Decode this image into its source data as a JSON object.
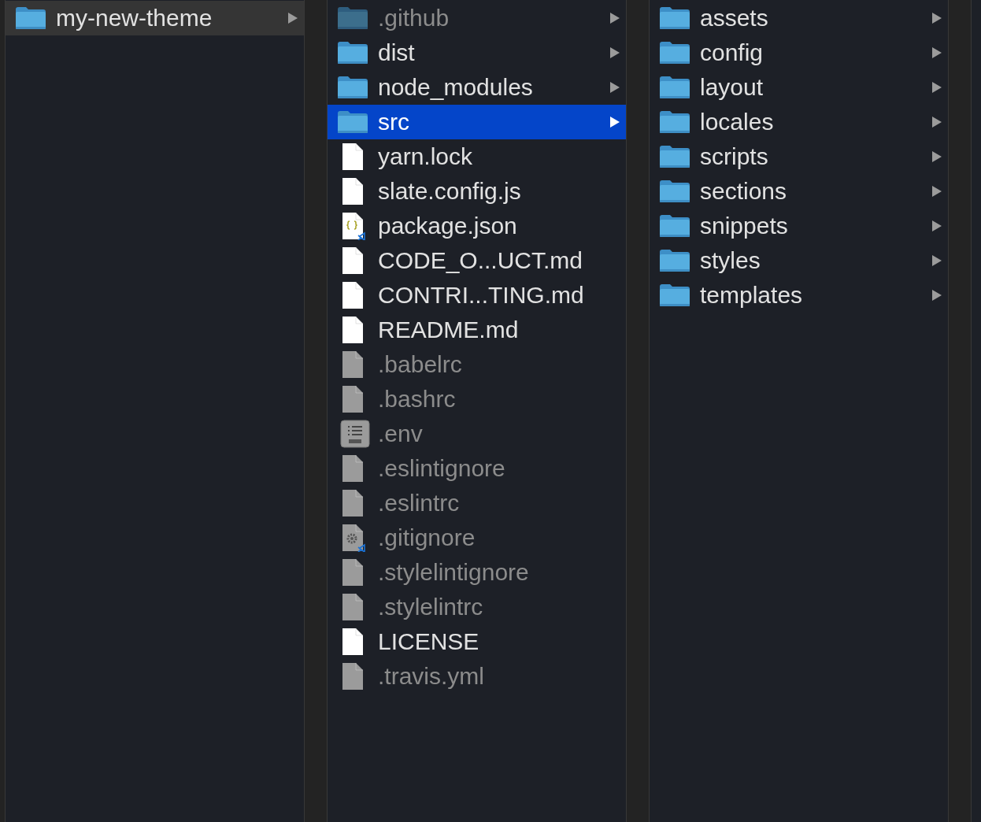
{
  "columns": [
    {
      "focused": false,
      "items": [
        {
          "name": "my-new-theme",
          "kind": "folder",
          "hidden": false,
          "selected": true
        }
      ]
    },
    {
      "focused": true,
      "items": [
        {
          "name": ".github",
          "kind": "folder",
          "hidden": true,
          "selected": false
        },
        {
          "name": "dist",
          "kind": "folder",
          "hidden": false,
          "selected": false
        },
        {
          "name": "node_modules",
          "kind": "folder",
          "hidden": false,
          "selected": false
        },
        {
          "name": "src",
          "kind": "folder",
          "hidden": false,
          "selected": true
        },
        {
          "name": "yarn.lock",
          "kind": "document",
          "hidden": false,
          "selected": false
        },
        {
          "name": "slate.config.js",
          "kind": "document",
          "hidden": false,
          "selected": false
        },
        {
          "name": "package.json",
          "kind": "json-document",
          "hidden": false,
          "selected": false
        },
        {
          "name": "CODE_O...UCT.md",
          "kind": "document",
          "hidden": false,
          "selected": false
        },
        {
          "name": "CONTRI...TING.md",
          "kind": "document",
          "hidden": false,
          "selected": false
        },
        {
          "name": "README.md",
          "kind": "document",
          "hidden": false,
          "selected": false
        },
        {
          "name": ".babelrc",
          "kind": "document",
          "hidden": true,
          "selected": false
        },
        {
          "name": ".bashrc",
          "kind": "document",
          "hidden": true,
          "selected": false
        },
        {
          "name": ".env",
          "kind": "dict-document",
          "hidden": true,
          "selected": false
        },
        {
          "name": ".eslintignore",
          "kind": "document",
          "hidden": true,
          "selected": false
        },
        {
          "name": ".eslintrc",
          "kind": "document",
          "hidden": true,
          "selected": false
        },
        {
          "name": ".gitignore",
          "kind": "settings-document",
          "hidden": true,
          "selected": false
        },
        {
          "name": ".stylelintignore",
          "kind": "document",
          "hidden": true,
          "selected": false
        },
        {
          "name": ".stylelintrc",
          "kind": "document",
          "hidden": true,
          "selected": false
        },
        {
          "name": "LICENSE",
          "kind": "document",
          "hidden": false,
          "selected": false
        },
        {
          "name": ".travis.yml",
          "kind": "document",
          "hidden": true,
          "selected": false
        }
      ]
    },
    {
      "items": [
        {
          "name": "assets",
          "kind": "folder",
          "hidden": false,
          "selected": false
        },
        {
          "name": "config",
          "kind": "folder",
          "hidden": false,
          "selected": false
        },
        {
          "name": "layout",
          "kind": "folder",
          "hidden": false,
          "selected": false
        },
        {
          "name": "locales",
          "kind": "folder",
          "hidden": false,
          "selected": false
        },
        {
          "name": "scripts",
          "kind": "folder",
          "hidden": false,
          "selected": false
        },
        {
          "name": "sections",
          "kind": "folder",
          "hidden": false,
          "selected": false
        },
        {
          "name": "snippets",
          "kind": "folder",
          "hidden": false,
          "selected": false
        },
        {
          "name": "styles",
          "kind": "folder",
          "hidden": false,
          "selected": false
        },
        {
          "name": "templates",
          "kind": "folder",
          "hidden": false,
          "selected": false
        }
      ]
    }
  ]
}
